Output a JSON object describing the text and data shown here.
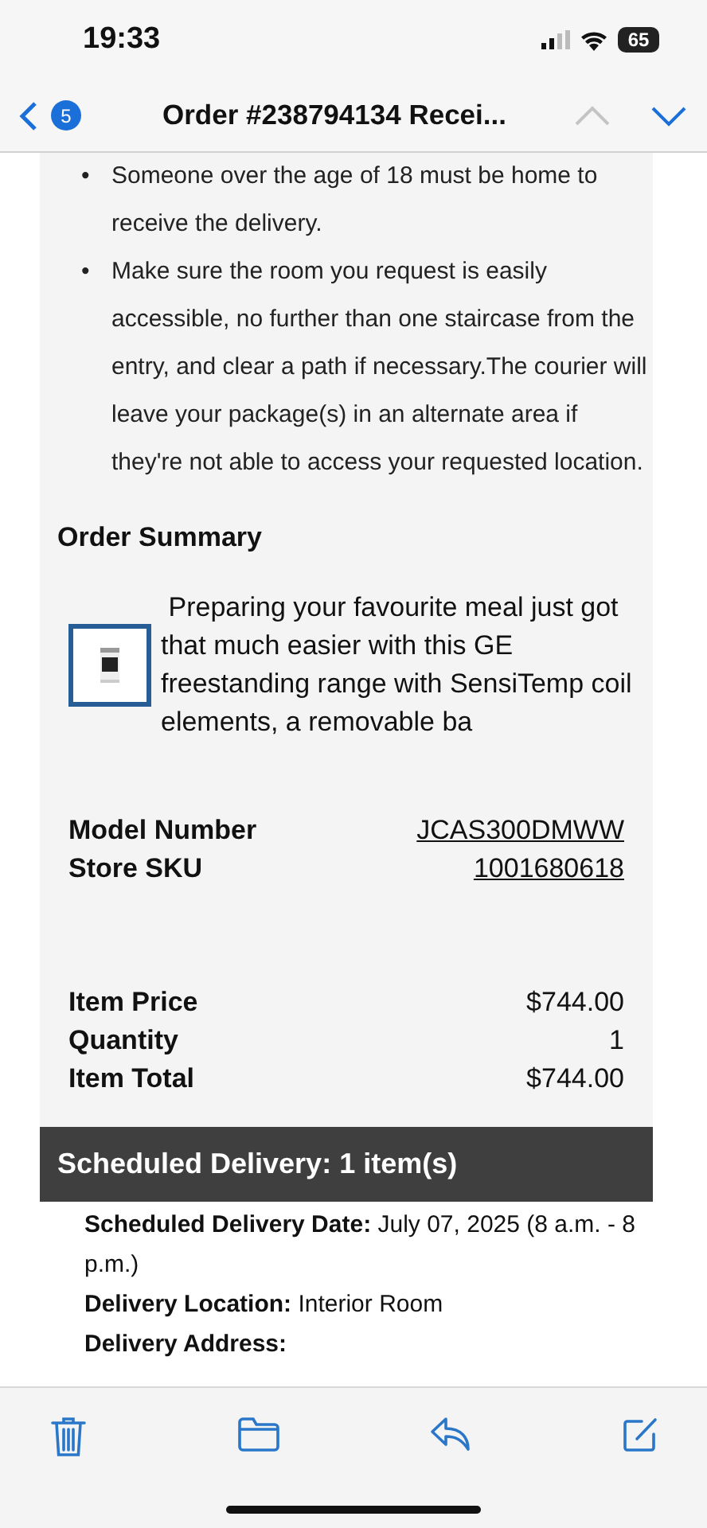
{
  "status_bar": {
    "time": "19:33",
    "battery": "65"
  },
  "nav": {
    "unread_count": "5",
    "title": "Order #238794134 Recei...",
    "previous_disabled": true,
    "next_disabled": false
  },
  "notes": [
    {
      "marker": "•",
      "text": "Someone over the age of 18 must be home to receive the delivery."
    },
    {
      "marker": "•",
      "text": "Make sure the room you request is easily accessible, no further than one staircase from the entry, and clear a path if necessary.The courier will leave your package(s) in an alternate area if they're not able to access your requested location."
    }
  ],
  "order_summary": {
    "heading": "Order Summary",
    "product": {
      "description": " Preparing your favourite meal just got that much easier with this GE freestanding range with SensiTemp coil elements, a removable ba"
    },
    "identifiers": [
      {
        "label": "Model Number",
        "value": "JCAS300DMWW"
      },
      {
        "label": "Store SKU",
        "value": "1001680618"
      }
    ],
    "pricing": [
      {
        "label": "Item Price",
        "value": "$744.00"
      },
      {
        "label": "Quantity",
        "value": "1"
      },
      {
        "label": "Item Total",
        "value": "$744.00"
      }
    ]
  },
  "delivery": {
    "heading": "Scheduled Delivery: 1 item(s)",
    "lines": [
      {
        "label": "Scheduled Delivery Date:",
        "value": "July 07, 2025 (8 a.m. - 8 p.m.)"
      },
      {
        "label": "Delivery Location:",
        "value": "Interior Room"
      },
      {
        "label": "Delivery Address:"
      }
    ]
  },
  "toolbar": [
    {
      "kind": "trash"
    },
    {
      "kind": "folder"
    },
    {
      "kind": "reply"
    },
    {
      "kind": "compose"
    }
  ]
}
